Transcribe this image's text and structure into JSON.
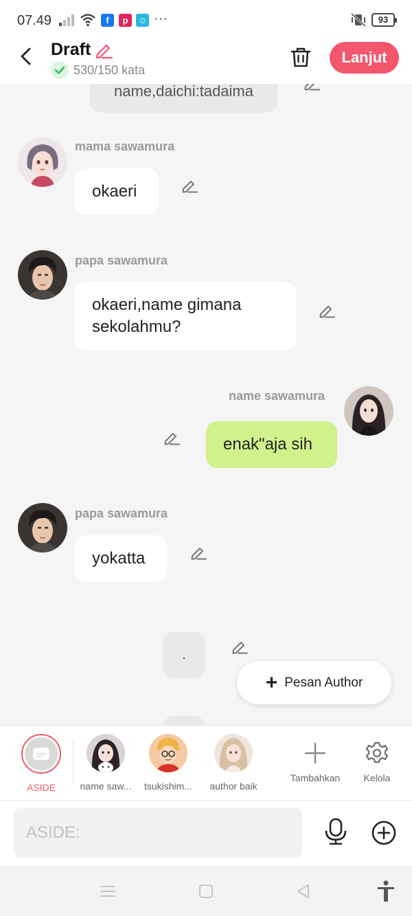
{
  "status": {
    "time": "07.49",
    "battery": "93",
    "overflow": "···"
  },
  "header": {
    "title": "Draft",
    "word_count": "530/150 kata",
    "next_label": "Lanjut"
  },
  "messages": [
    {
      "sender": "",
      "text": "name,daichi:tadaima",
      "side": "center"
    },
    {
      "sender": "mama sawamura",
      "text": "okaeri",
      "side": "left"
    },
    {
      "sender": "papa sawamura",
      "text": "okaeri,name gimana sekolahmu?",
      "side": "left"
    },
    {
      "sender": "name sawamura",
      "text": "enak\"aja sih",
      "side": "right"
    },
    {
      "sender": "papa sawamura",
      "text": "yokatta",
      "side": "left"
    },
    {
      "sender": "",
      "text": ".",
      "side": "center"
    }
  ],
  "fab": {
    "label": "Pesan Author"
  },
  "characters": [
    {
      "label": "ASIDE"
    },
    {
      "label": "name saw..."
    },
    {
      "label": "tsukishim..."
    },
    {
      "label": "author baik"
    },
    {
      "label": "Tambahkan"
    },
    {
      "label": "Kelola"
    }
  ],
  "input": {
    "placeholder": "ASIDE:"
  },
  "colors": {
    "accent": "#f4566e",
    "my_bubble": "#d1f18c",
    "background": "#f5f5f5"
  }
}
